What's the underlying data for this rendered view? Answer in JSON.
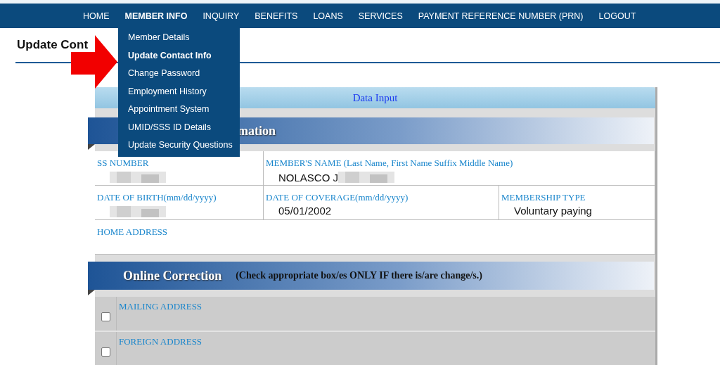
{
  "nav": [
    {
      "label": "HOME",
      "selected": false
    },
    {
      "label": "MEMBER INFO",
      "selected": true
    },
    {
      "label": "INQUIRY",
      "selected": false
    },
    {
      "label": "BENEFITS",
      "selected": false
    },
    {
      "label": "LOANS",
      "selected": false
    },
    {
      "label": "SERVICES",
      "selected": false
    },
    {
      "label": "PAYMENT REFERENCE NUMBER (PRN)",
      "selected": false
    },
    {
      "label": "LOGOUT",
      "selected": false
    }
  ],
  "menu": [
    {
      "label": "Member Details",
      "selected": false
    },
    {
      "label": "Update Contact Info",
      "selected": true
    },
    {
      "label": "Change Password",
      "selected": false
    },
    {
      "label": "Employment History",
      "selected": false
    },
    {
      "label": "Appointment System",
      "selected": false
    },
    {
      "label": "UMID/SSS ID Details",
      "selected": false
    },
    {
      "label": "Update Security Questions",
      "selected": false
    }
  ],
  "page_title": "Update Cont",
  "panel": {
    "title": "Data Input",
    "info_section": {
      "heading": "mation",
      "rows": [
        [
          {
            "label": "SS NUMBER",
            "redacted": true
          },
          {
            "label": "MEMBER'S NAME  (Last Name, First Name Suffix Middle Name)",
            "value": "NOLASCO J",
            "redacted": true
          }
        ],
        [
          {
            "label": "DATE OF BIRTH(mm/dd/yyyy)",
            "redacted": true
          },
          {
            "label": "DATE OF COVERAGE(mm/dd/yyyy)",
            "value": "05/01/2002",
            "redacted": false
          },
          {
            "label": "MEMBERSHIP TYPE",
            "value": "Voluntary paying",
            "redacted": false
          }
        ],
        [
          {
            "label": "HOME ADDRESS",
            "redacted": false
          }
        ]
      ]
    },
    "correction_section": {
      "heading": "Online Correction",
      "note": "(Check appropriate box/es ONLY IF there is/are change/s.)",
      "items": [
        {
          "label": "MAILING ADDRESS",
          "checked": false
        },
        {
          "label": "FOREIGN ADDRESS",
          "checked": false
        }
      ]
    }
  }
}
